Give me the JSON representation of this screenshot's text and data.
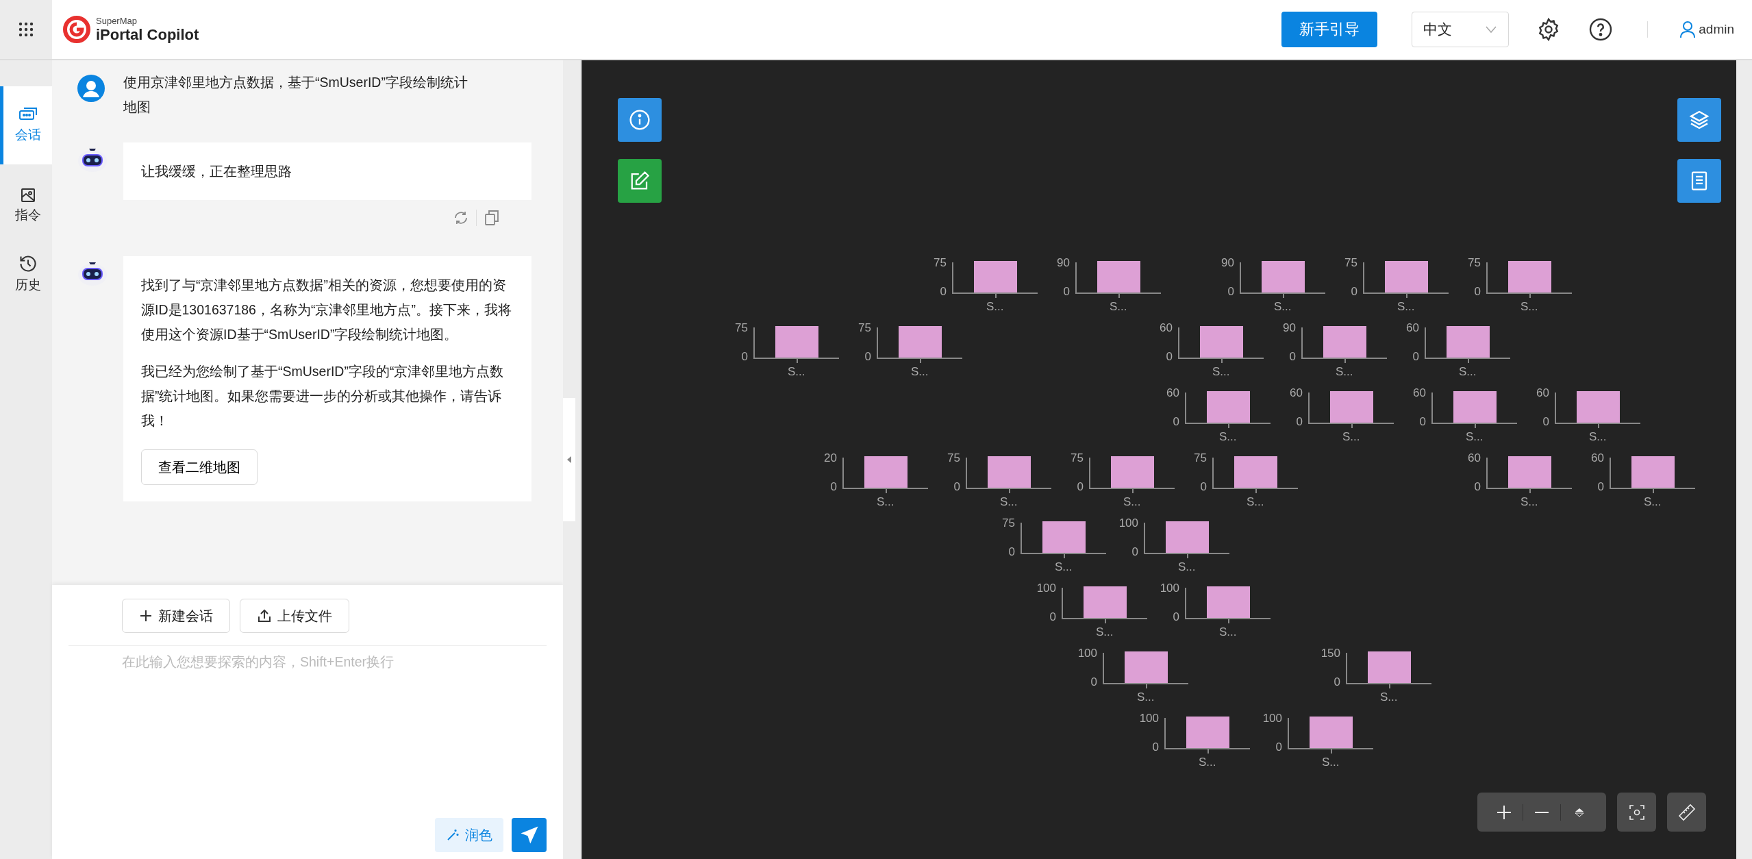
{
  "header": {
    "logo": {
      "brand": "SuperMap",
      "product": "iPortal Copilot"
    },
    "guide_button": "新手引导",
    "language": "中文",
    "user": "admin"
  },
  "sidebar": {
    "items": [
      {
        "label": "会话",
        "kind": "chat",
        "selected": true
      },
      {
        "label": "指令",
        "kind": "command",
        "selected": false
      },
      {
        "label": "历史",
        "kind": "history",
        "selected": false
      }
    ]
  },
  "messages": [
    {
      "kind": "user",
      "paragraphs": [
        "使用京津邻里地方点数据，基于“SmUserID”字段绘制统计地图"
      ]
    },
    {
      "kind": "bot",
      "paragraphs": [
        "让我缓缓，正在整理思路"
      ],
      "actions": true
    },
    {
      "kind": "bot",
      "paragraphs": [
        "找到了与“京津邻里地方点数据”相关的资源，您想要使用的资源ID是1301637186，名称为“京津邻里地方点”。接下来，我将使用这个资源ID基于“SmUserID”字段绘制统计地图。",
        "我已经为您绘制了基于“SmUserID”字段的“京津邻里地方点数据”统计地图。如果您需要进一步的分析或其他操作，请告诉我！"
      ],
      "button": "查看二维地图"
    }
  ],
  "composer": {
    "buttons": [
      {
        "label": "新建会话",
        "kind": "new"
      },
      {
        "label": "上传文件",
        "kind": "upload"
      }
    ],
    "placeholder": "在此输入您想要探索的内容，Shift+Enter换行",
    "polish_button": "润色"
  },
  "map": {
    "markers": [
      {
        "max": "75",
        "min": "0",
        "label": "S..."
      },
      {
        "max": "90",
        "min": "0",
        "label": "S..."
      },
      {
        "max": "90",
        "min": "0",
        "label": "S..."
      },
      {
        "max": "75",
        "min": "0",
        "label": "S..."
      },
      {
        "max": "75",
        "min": "0",
        "label": "S..."
      },
      {
        "max": "75",
        "min": "0",
        "label": "S..."
      },
      {
        "max": "75",
        "min": "0",
        "label": "S..."
      },
      {
        "max": "60",
        "min": "0",
        "label": "S..."
      },
      {
        "max": "90",
        "min": "0",
        "label": "S..."
      },
      {
        "max": "60",
        "min": "0",
        "label": "S..."
      },
      {
        "max": "60",
        "min": "0",
        "label": "S..."
      },
      {
        "max": "60",
        "min": "0",
        "label": "S..."
      },
      {
        "max": "60",
        "min": "0",
        "label": "S..."
      },
      {
        "max": "60",
        "min": "0",
        "label": "S..."
      },
      {
        "max": "20",
        "min": "0",
        "label": "S..."
      },
      {
        "max": "75",
        "min": "0",
        "label": "S..."
      },
      {
        "max": "75",
        "min": "0",
        "label": "S..."
      },
      {
        "max": "75",
        "min": "0",
        "label": "S..."
      },
      {
        "max": "60",
        "min": "0",
        "label": "S..."
      },
      {
        "max": "60",
        "min": "0",
        "label": "S..."
      },
      {
        "max": "75",
        "min": "0",
        "label": "S..."
      },
      {
        "max": "100",
        "min": "0",
        "label": "S..."
      },
      {
        "max": "100",
        "min": "0",
        "label": "S..."
      },
      {
        "max": "100",
        "min": "0",
        "label": "S..."
      },
      {
        "max": "100",
        "min": "0",
        "label": "S..."
      },
      {
        "max": "150",
        "min": "0",
        "label": "S..."
      },
      {
        "max": "100",
        "min": "0",
        "label": "S..."
      },
      {
        "max": "100",
        "min": "0",
        "label": "S..."
      }
    ]
  }
}
